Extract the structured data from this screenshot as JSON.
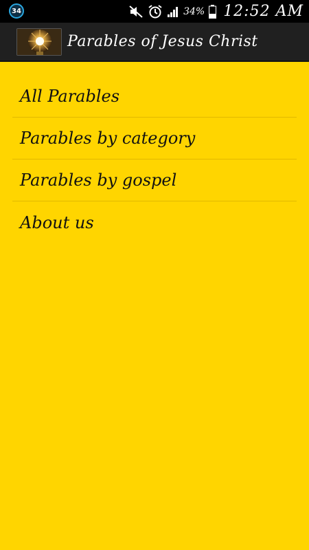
{
  "status_bar": {
    "notification_count": "34",
    "battery_percent": "34%",
    "time": "12:52 AM",
    "icons": [
      "mute-icon",
      "alarm-icon",
      "signal-icon",
      "battery-icon"
    ]
  },
  "action_bar": {
    "logo": "app-logo-image",
    "title": "Parables of Jesus Christ"
  },
  "menu": {
    "items": [
      {
        "label": "All Parables"
      },
      {
        "label": "Parables by category"
      },
      {
        "label": "Parables by gospel"
      },
      {
        "label": "About us"
      }
    ]
  },
  "colors": {
    "background": "#FFD500",
    "action_bar": "#202020",
    "status_bar": "#000000"
  }
}
